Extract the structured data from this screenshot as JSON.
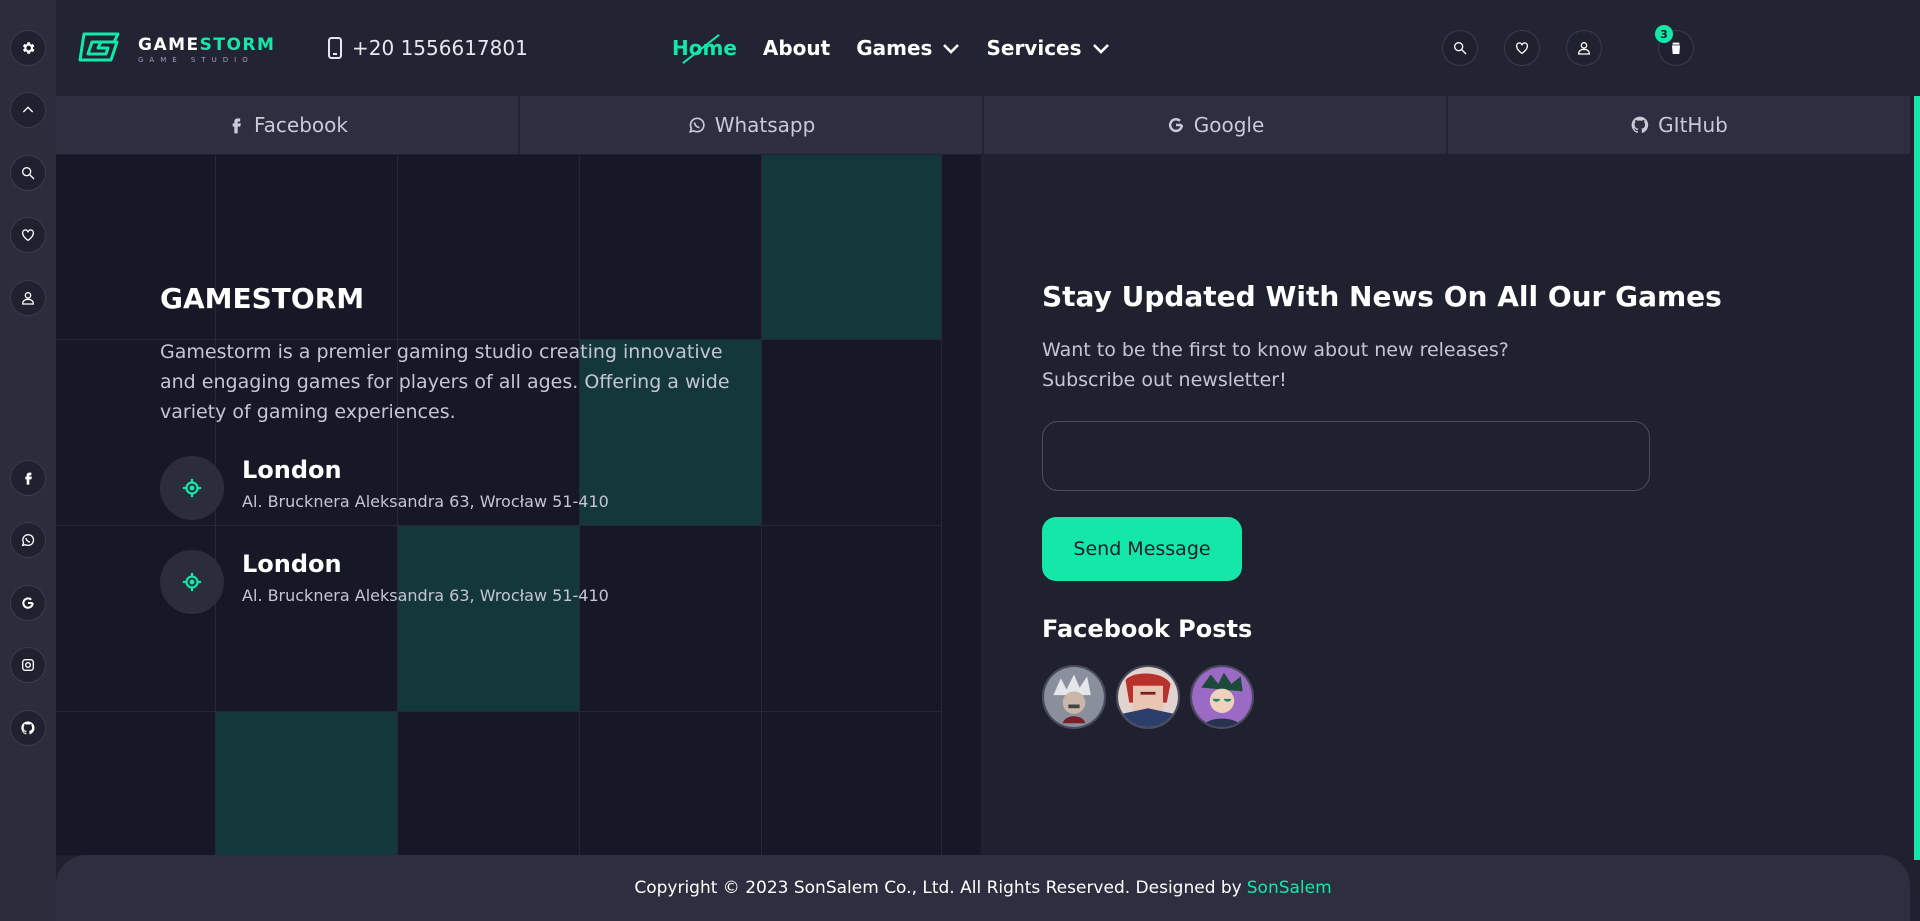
{
  "brand": {
    "name_white": "GAME",
    "name_green": "STORM",
    "tagline": "GAME STUDIO"
  },
  "header": {
    "phone": "+20 1556617801",
    "nav": [
      {
        "label": "Home",
        "active": true,
        "dropdown": false
      },
      {
        "label": "About",
        "active": false,
        "dropdown": false
      },
      {
        "label": "Games",
        "active": false,
        "dropdown": true
      },
      {
        "label": "Services",
        "active": false,
        "dropdown": true
      }
    ],
    "icons": [
      "search-icon",
      "heart-icon",
      "user-icon",
      "cart-icon"
    ],
    "cart_count": "3"
  },
  "sidebar": {
    "top_icons": [
      "gear-icon",
      "chevron-up-icon",
      "search-icon",
      "heart-icon",
      "user-icon"
    ],
    "social_icons": [
      "facebook-icon",
      "whatsapp-icon",
      "google-icon",
      "instagram-icon",
      "github-icon"
    ]
  },
  "social_links": [
    {
      "label": "Facebook",
      "icon": "facebook-icon"
    },
    {
      "label": "Whatsapp",
      "icon": "whatsapp-icon"
    },
    {
      "label": "Google",
      "icon": "google-icon"
    },
    {
      "label": "GItHub",
      "icon": "github-icon"
    }
  ],
  "about": {
    "title": "GAMESTORM",
    "text": "Gamestorm is a premier gaming studio creating innovative and engaging games for players of all ages. Offering a wide variety of gaming experiences.",
    "locations": [
      {
        "city": "London",
        "address": "Al. Brucknera Aleksandra 63, Wrocław 51-410"
      },
      {
        "city": "London",
        "address": "Al. Brucknera Aleksandra 63, Wrocław 51-410"
      }
    ]
  },
  "newsletter": {
    "title": "Stay Updated With News On All Our Games",
    "text": "Want to be the first to know about new releases? Subscribe out newsletter!",
    "input_value": "",
    "button": "Send Message",
    "facebook_title": "Facebook Posts",
    "posts": [
      "post-1",
      "post-2",
      "post-3"
    ]
  },
  "footer": {
    "copyright": "Copyright © 2023 SonSalem Co., Ltd. All Rights Reserved. Designed by",
    "designer": "SonSalem"
  },
  "colors": {
    "accent": "#13e8a8",
    "background": "#20212f",
    "panel": "#171826",
    "highlight": "#14383a"
  }
}
